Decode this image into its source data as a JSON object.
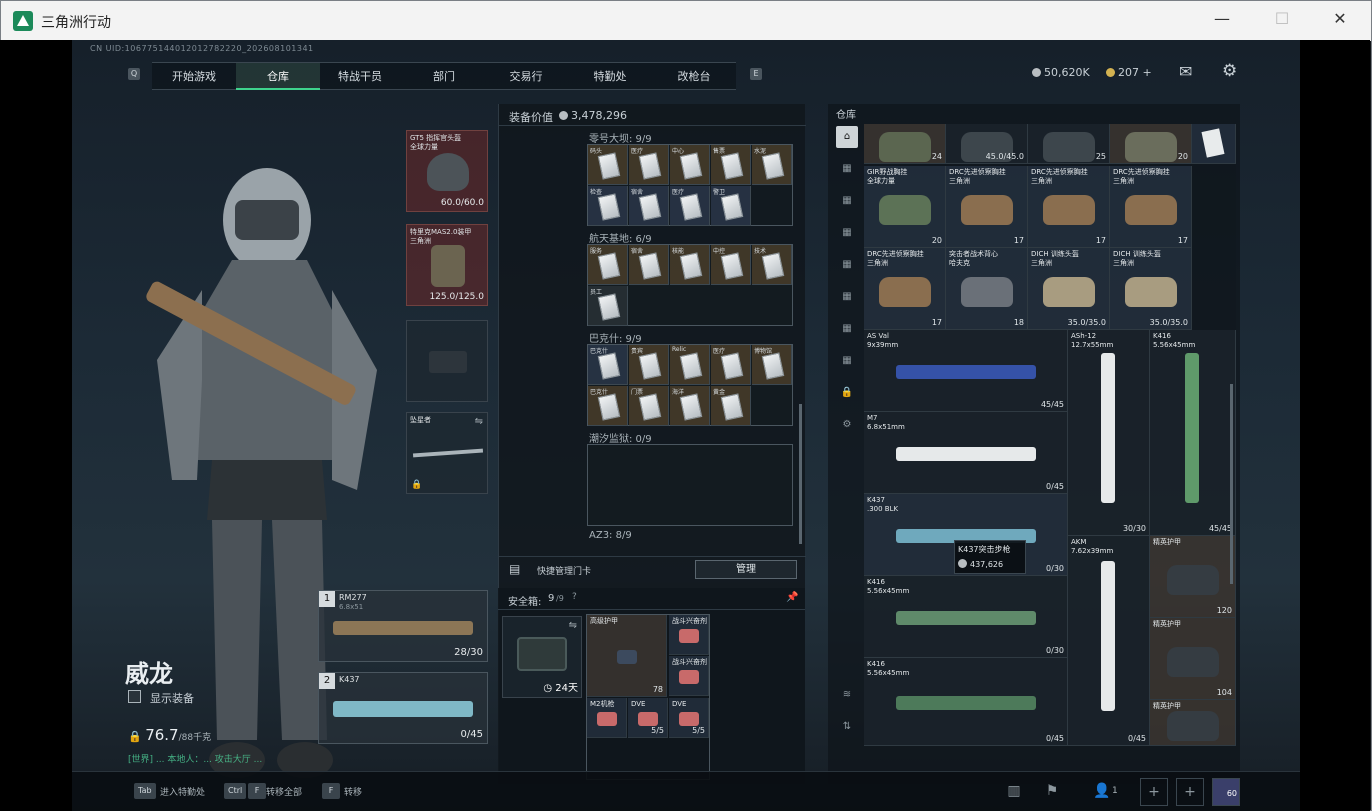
{
  "window": {
    "title": "三角洲行动",
    "min": "—",
    "max": "☐",
    "close": "✕"
  },
  "header": {
    "uid": "CN UID:10677514401201278222​0_202608101341",
    "nav_left_key": "Q",
    "nav_right_key": "E",
    "tabs": [
      "开始游戏",
      "仓库",
      "特战干员",
      "部门",
      "交易行",
      "特勤处",
      "改枪台"
    ],
    "active_tab": "仓库",
    "silver": "50,620K",
    "gold": "207",
    "plus": "+"
  },
  "loadout": {
    "helmet": {
      "name": "GT5 指挥官头盔\n全球力量",
      "value": "60.0/60.0"
    },
    "armor": {
      "name": "特里克MAS2.0装甲\n三角洲",
      "value": "125.0/125.0"
    },
    "melee": {
      "name": "坠星者"
    },
    "primary": {
      "num": "1",
      "name": "RM277",
      "sub": "6.8x51",
      "ammo": "28/30"
    },
    "secondary": {
      "num": "2",
      "name": "K437",
      "ammo": "0/45"
    },
    "char_name": "威龙",
    "show_equipment": "显示装备",
    "weight": "76.7",
    "weight_cap": "/88千克",
    "chat": "[世界] ... 本地人：... 攻击大厅 ..."
  },
  "mid": {
    "equip_value_label": "装备价值",
    "equip_value": "3,478,296",
    "sections": [
      {
        "label": "零号大坝: 9/9"
      },
      {
        "label": "航天基地: 6/9"
      },
      {
        "label": "巴克什: 9/9"
      },
      {
        "label": "潮汐监狱: 0/9"
      },
      {
        "label": "AZ3: 8/9"
      }
    ],
    "cards_dam": [
      "码头",
      "医疗",
      "中心",
      "售票",
      "水泥",
      "检查",
      "宿舍",
      "医疗",
      "警卫"
    ],
    "cards_space": [
      "服务",
      "宿舍",
      "核能",
      "中控",
      "技术",
      "员工"
    ],
    "cards_baksh": [
      "巴克什",
      "贵宾",
      "Relic",
      "医疗",
      "博物馆",
      "巴克什",
      "门票",
      "海洋",
      "黄金"
    ],
    "quick_label": "快捷管理门卡",
    "manage": "管理",
    "safe_label": "安全箱:",
    "safe_count": "9",
    "safe_cap": "/9",
    "safe_days": "24天",
    "safe_items": [
      {
        "name": "高级护甲",
        "val": "78"
      },
      {
        "name": "战斗兴奋剂"
      },
      {
        "name": "战斗兴奋剂"
      },
      {
        "name": "M2机枪"
      },
      {
        "name": "DVE",
        "val": "5/5"
      },
      {
        "name": "DVE",
        "val": "5/5"
      }
    ]
  },
  "stash": {
    "title": "仓库",
    "top_row": [
      {
        "val": "24"
      },
      {
        "val": "45.0/45.0"
      },
      {
        "val": "25"
      },
      {
        "val": "20"
      }
    ],
    "bags_row1": [
      {
        "name": "GIR野战胸挂\n全球力量",
        "val": "20"
      },
      {
        "name": "DRC先进侦察胸挂\n三角洲",
        "val": "17"
      },
      {
        "name": "DRC先进侦察胸挂\n三角洲",
        "val": "17"
      },
      {
        "name": "DRC先进侦察胸挂\n三角洲",
        "val": "17"
      }
    ],
    "bags_row2": [
      {
        "name": "DRC先进侦察胸挂\n三角洲",
        "val": "17"
      },
      {
        "name": "突击者战术背心\n哈夫克",
        "val": "18"
      },
      {
        "name": "DICH 训练头盔\n三角洲",
        "val": "35.0/35.0"
      },
      {
        "name": "DICH 训练头盔\n三角洲",
        "val": "35.0/35.0"
      }
    ],
    "guns": [
      {
        "name": "AS Val\n9x39mm",
        "ammo": "45/45"
      },
      {
        "name": "ASh-12\n12.7x55mm",
        "ammo": "30/30"
      },
      {
        "name": "K416\n5.56x45mm",
        "ammo": "45/45"
      },
      {
        "name": "M7\n6.8x51mm",
        "ammo": "0/45"
      },
      {
        "name": "K437\n.300 BLK",
        "ammo": "0/30"
      },
      {
        "name": "AKM\n7.62x39mm",
        "ammo": "0/45"
      },
      {
        "name": "K416\n5.56x45mm",
        "ammo": "0/30"
      },
      {
        "name": "K416\n5.56x45mm",
        "ammo": "0/45"
      }
    ],
    "tooltip": {
      "name": "K437突击步枪",
      "value": "437,626"
    },
    "armors": [
      {
        "name": "精英护甲",
        "val": "120"
      },
      {
        "name": "精英护甲",
        "val": "104"
      },
      {
        "name": "精英护甲"
      }
    ]
  },
  "bottom": {
    "k1": "Tab",
    "t1": "进入特勤处",
    "k2": "Ctrl",
    "k2b": "F",
    "t2": "转移全部",
    "k3": "F",
    "t3": "转移",
    "squad": "1",
    "level": "60"
  }
}
